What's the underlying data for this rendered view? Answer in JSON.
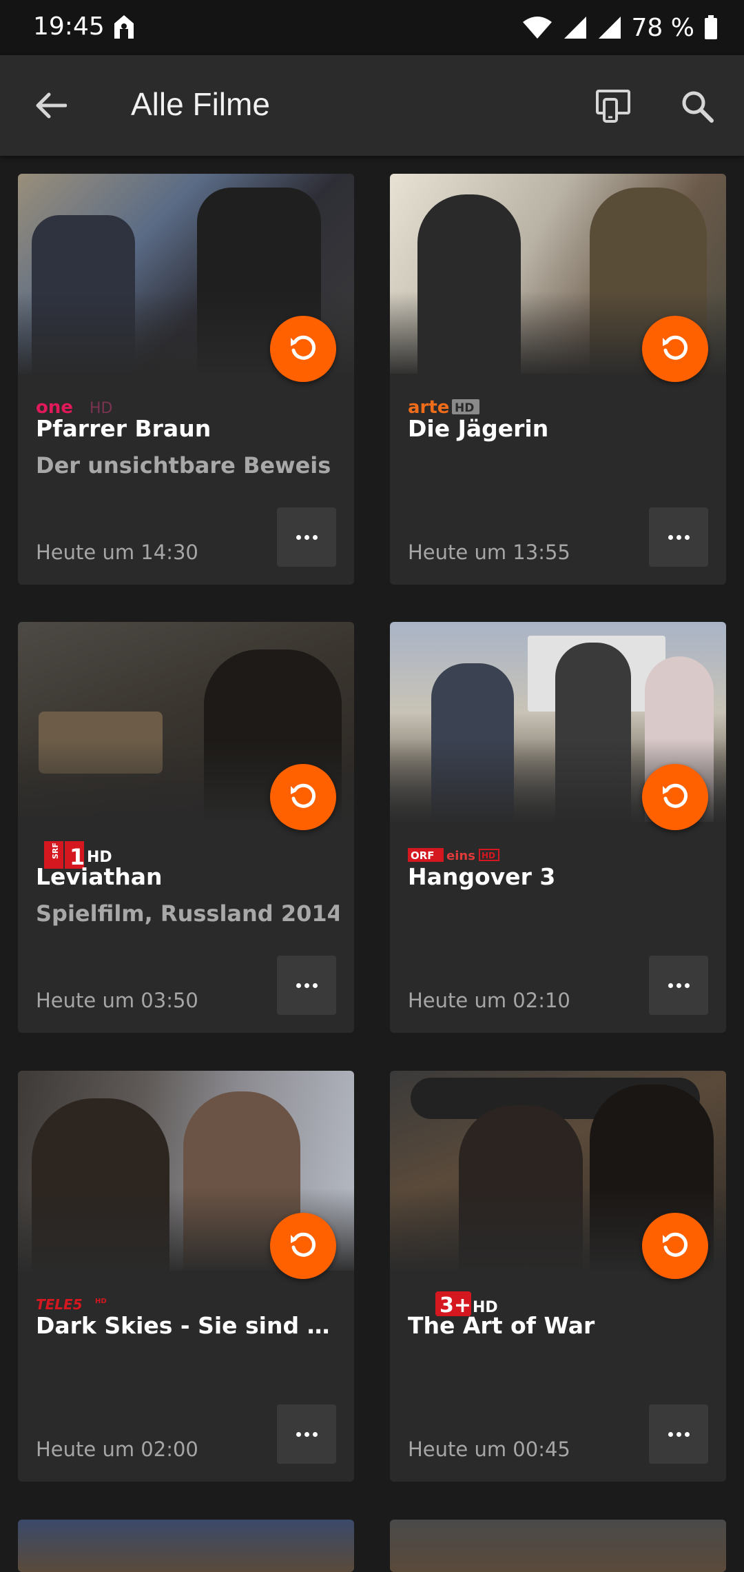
{
  "status_bar": {
    "time": "19:45",
    "battery": "78 %"
  },
  "app_bar": {
    "title": "Alle Filme"
  },
  "movies": [
    {
      "channel": "one HD",
      "title": "Pfarrer Braun",
      "subtitle": "Der unsichtbare Beweis",
      "time": "Heute um 14:30"
    },
    {
      "channel": "arte HD",
      "title": "Die Jägerin",
      "subtitle": "",
      "time": "Heute um 13:55"
    },
    {
      "channel": "SRF 1 HD",
      "title": "Leviathan",
      "subtitle": "Spielfilm, Russland 2014",
      "time": "Heute um 03:50"
    },
    {
      "channel": "ORF eins HD",
      "title": "Hangover 3",
      "subtitle": "",
      "time": "Heute um 02:10"
    },
    {
      "channel": "TELE 5 HD",
      "title": "Dark Skies - Sie sind unt...",
      "subtitle": "",
      "time": "Heute um 02:00"
    },
    {
      "channel": "3+ HD",
      "title": "The Art of War",
      "subtitle": "",
      "time": "Heute um 00:45"
    }
  ],
  "colors": {
    "accent": "#ff6000",
    "background": "#1b1b1b",
    "card": "#2a2a2a",
    "appbar": "#2b2b2b"
  }
}
